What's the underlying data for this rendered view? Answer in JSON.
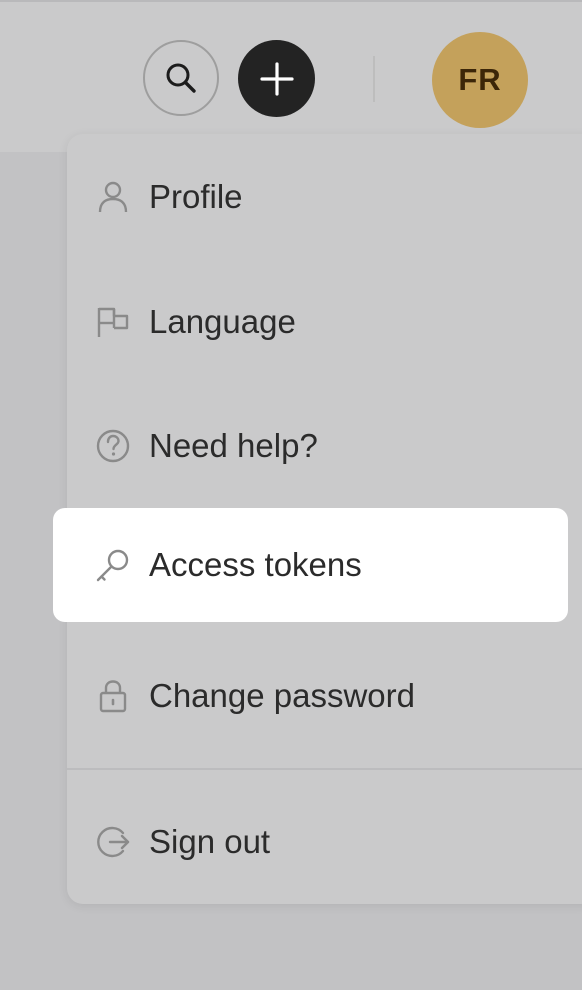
{
  "header": {
    "avatar_initials": "FR"
  },
  "colors": {
    "page_bg": "#c2c2c4",
    "avatar_bg": "#c4a15b",
    "add_button_bg": "#232323",
    "highlight_bg": "#ffffff"
  },
  "menu": {
    "items": [
      {
        "label": "Profile",
        "icon": "person-icon"
      },
      {
        "label": "Language",
        "icon": "flag-icon"
      },
      {
        "label": "Need help?",
        "icon": "help-circle-icon"
      },
      {
        "label": "Access tokens",
        "icon": "key-icon"
      },
      {
        "label": "Change password",
        "icon": "lock-icon"
      },
      {
        "label": "Sign out",
        "icon": "sign-out-icon"
      }
    ],
    "highlighted_item": "Access tokens"
  }
}
